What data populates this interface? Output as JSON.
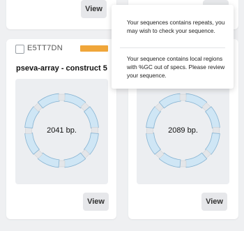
{
  "cards": [
    {
      "view_label": "View"
    },
    {
      "view_label": "View"
    },
    {
      "id": "E5TT7DN",
      "title": "pseva-array - construct 5",
      "bp": "2041 bp.",
      "view_label": "View",
      "status_color": "#f0a63a"
    },
    {
      "bp": "2089 bp.",
      "view_label": "View"
    }
  ],
  "tooltip": {
    "messages": [
      "Your sequences contains repeats, you may wish to check your sequence.",
      "Your sequence contains local regions with %GC out of specs. Please review your sequence."
    ]
  },
  "colors": {
    "segment_fill": "#cfe6f5",
    "segment_stroke": "#86b3d2",
    "connector": "#e4e6e9",
    "status": "#f0a63a"
  }
}
